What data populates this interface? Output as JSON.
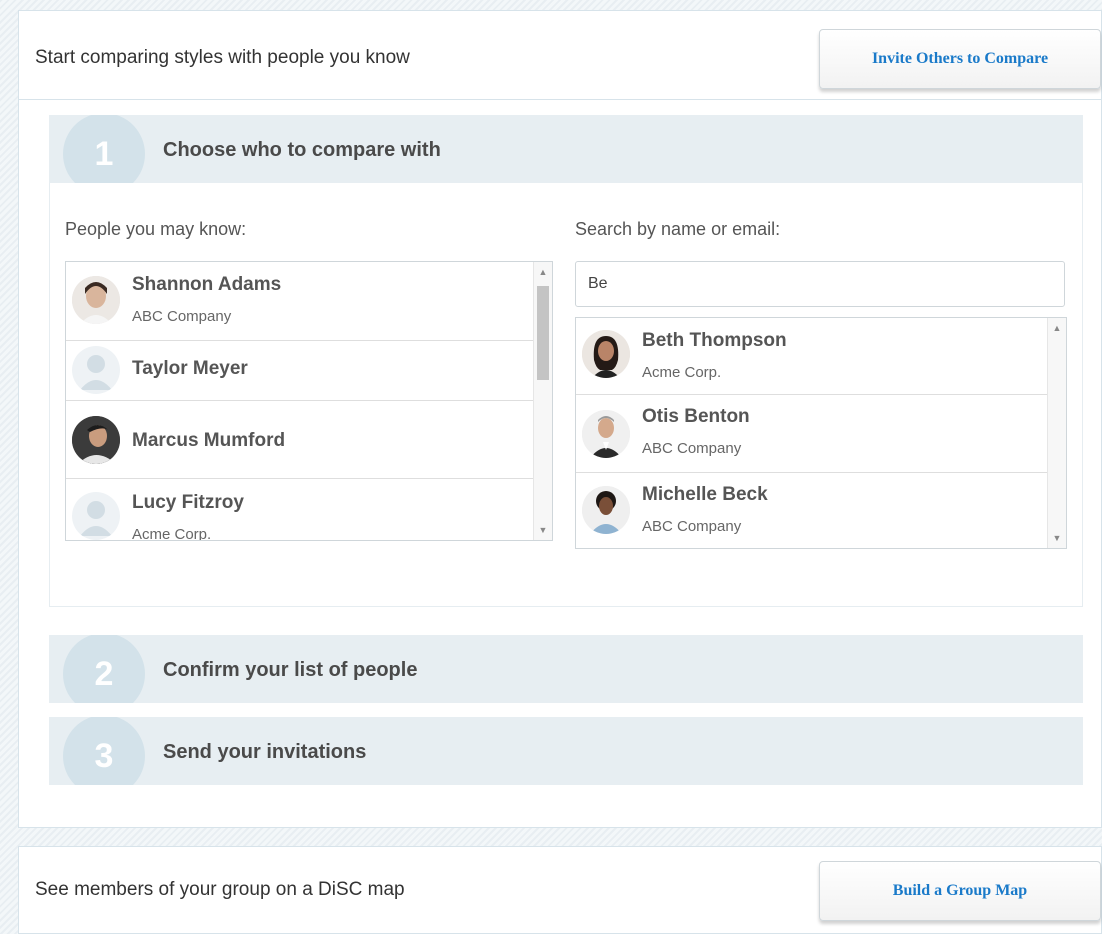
{
  "compare_panel": {
    "title": "Start comparing styles with people you know",
    "invite_button": "Invite Others to Compare",
    "steps": [
      {
        "number": "1",
        "label": "Choose who to compare with"
      },
      {
        "number": "2",
        "label": "Confirm your list of people"
      },
      {
        "number": "3",
        "label": "Send your invitations"
      }
    ],
    "people_label": "People you may know:",
    "search_label": "Search by name or email:",
    "search_value": "Be",
    "people": [
      {
        "name": "Shannon Adams",
        "company": "ABC Company",
        "icon": "shannon-avatar"
      },
      {
        "name": "Taylor Meyer",
        "company": "",
        "icon": "default-avatar-icon"
      },
      {
        "name": "Marcus Mumford",
        "company": "",
        "icon": "marcus-avatar"
      },
      {
        "name": "Lucy Fitzroy",
        "company": "Acme Corp.",
        "icon": "default-avatar-icon"
      }
    ],
    "results": [
      {
        "name": "Beth Thompson",
        "company": "Acme Corp.",
        "icon": "beth-avatar"
      },
      {
        "name": "Otis Benton",
        "company": "ABC Company",
        "icon": "otis-avatar"
      },
      {
        "name": "Michelle Beck",
        "company": "ABC Company",
        "icon": "michelle-avatar"
      }
    ]
  },
  "group_panel": {
    "title": "See members of your group on a DiSC map",
    "button": "Build a Group Map"
  },
  "colors": {
    "accent": "#1a7ac9",
    "step_bg": "#e7eef2",
    "step_circle": "#d3e2ea"
  }
}
